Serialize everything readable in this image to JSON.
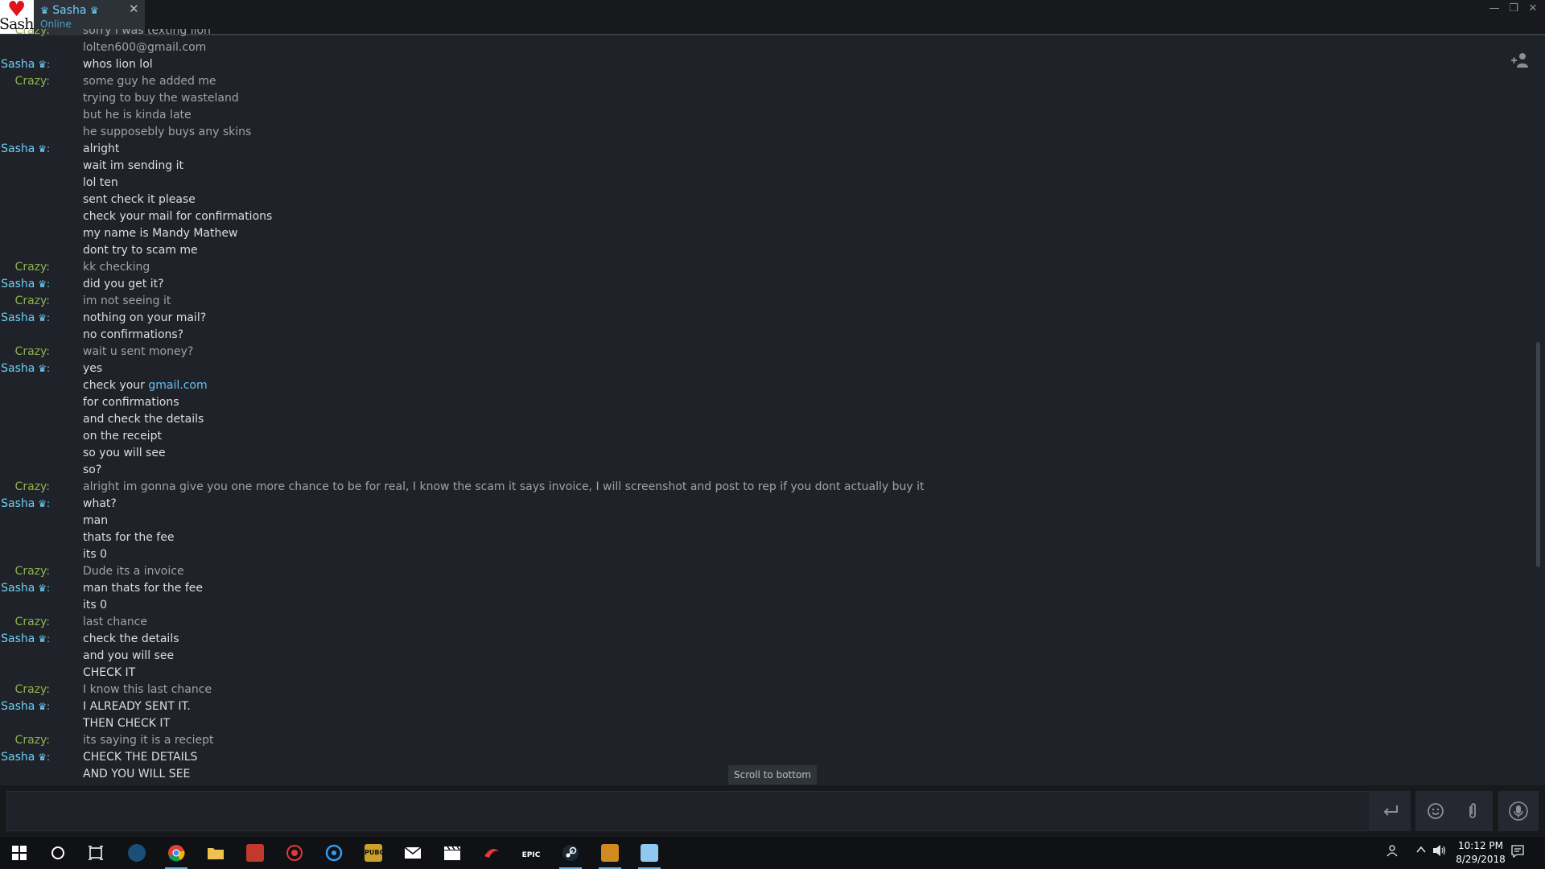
{
  "window": {
    "tab_name": "Sasha",
    "tab_status": "Online",
    "avatar_text": "Sasha",
    "close_glyph": "✕",
    "minimize_glyph": "—",
    "restore_glyph": "❐",
    "window_close_glyph": "✕"
  },
  "colors": {
    "sasha": "#6dcff6",
    "crazy": "#8fb34f",
    "link": "#67c1f5",
    "background": "#1f2228"
  },
  "senders": {
    "sasha": "Sasha",
    "crazy": "Crazy:"
  },
  "messages": [
    {
      "sender": "crazy",
      "text": "sorry i was texting lion"
    },
    {
      "sender": "",
      "text": "lolten600@gmail.com",
      "prev": "crazy"
    },
    {
      "sender": "sasha",
      "text": "whos lion lol"
    },
    {
      "sender": "crazy",
      "text": "some guy he added me"
    },
    {
      "sender": "",
      "text": "trying to buy the wasteland",
      "prev": "crazy"
    },
    {
      "sender": "",
      "text": "but he is kinda late",
      "prev": "crazy"
    },
    {
      "sender": "",
      "text": "he supposebly buys any skins",
      "prev": "crazy"
    },
    {
      "sender": "sasha",
      "text": "alright"
    },
    {
      "sender": "",
      "text": "wait im sending it",
      "prev": "sasha"
    },
    {
      "sender": "",
      "text": "lol ten",
      "prev": "sasha"
    },
    {
      "sender": "",
      "text": "sent check it please",
      "prev": "sasha"
    },
    {
      "sender": "",
      "text": "check your mail for confirmations",
      "prev": "sasha"
    },
    {
      "sender": "",
      "text": "my name is Mandy Mathew",
      "prev": "sasha"
    },
    {
      "sender": "",
      "text": "dont try to scam me",
      "prev": "sasha"
    },
    {
      "sender": "crazy",
      "text": "kk checking"
    },
    {
      "sender": "sasha",
      "text": "did you get it?"
    },
    {
      "sender": "crazy",
      "text": "im not seeing it"
    },
    {
      "sender": "sasha",
      "text": "nothing on your mail?"
    },
    {
      "sender": "",
      "text": "no confirmations?",
      "prev": "sasha"
    },
    {
      "sender": "crazy",
      "text": "wait u sent money?"
    },
    {
      "sender": "sasha",
      "text": "yes"
    },
    {
      "sender": "",
      "text": "check your ",
      "link": "gmail.com",
      "prev": "sasha"
    },
    {
      "sender": "",
      "text": "for confirmations",
      "prev": "sasha"
    },
    {
      "sender": "",
      "text": "and check the details",
      "prev": "sasha"
    },
    {
      "sender": "",
      "text": "on the receipt",
      "prev": "sasha"
    },
    {
      "sender": "",
      "text": "so you will see",
      "prev": "sasha"
    },
    {
      "sender": "",
      "text": "so?",
      "prev": "sasha"
    },
    {
      "sender": "crazy",
      "text": "alright im gonna give you one more chance to be for real, I know the scam it says invoice, I will screenshot and post to rep if you dont actually buy it"
    },
    {
      "sender": "sasha",
      "text": "what?"
    },
    {
      "sender": "",
      "text": "man",
      "prev": "sasha"
    },
    {
      "sender": "",
      "text": "thats for the fee",
      "prev": "sasha"
    },
    {
      "sender": "",
      "text": "its 0",
      "prev": "sasha"
    },
    {
      "sender": "crazy",
      "text": "Dude its a invoice"
    },
    {
      "sender": "sasha",
      "text": "man thats for the fee"
    },
    {
      "sender": "",
      "text": "its 0",
      "prev": "sasha"
    },
    {
      "sender": "crazy",
      "text": "last chance"
    },
    {
      "sender": "sasha",
      "text": "check the details"
    },
    {
      "sender": "",
      "text": "and you will see",
      "prev": "sasha"
    },
    {
      "sender": "",
      "text": "CHECK IT",
      "prev": "sasha"
    },
    {
      "sender": "crazy",
      "text": "I know this last chance"
    },
    {
      "sender": "sasha",
      "text": "I ALREADY SENT IT."
    },
    {
      "sender": "",
      "text": "THEN CHECK IT",
      "prev": "sasha"
    },
    {
      "sender": "crazy",
      "text": "its saying it is a reciept"
    },
    {
      "sender": "sasha",
      "text": "CHECK THE DETAILS"
    },
    {
      "sender": "",
      "text": "AND YOU WILL SEE",
      "prev": "sasha"
    }
  ],
  "scroll_to_bottom": "Scroll to bottom",
  "input": {
    "value": "",
    "send_icon": "enter-icon",
    "emoji_icon": "smiley-icon",
    "attach_icon": "paperclip-icon",
    "voice_icon": "microphone-icon"
  },
  "taskbar": {
    "time": "10:12 PM",
    "date": "8/29/2018",
    "apps": [
      {
        "name": "start",
        "icon": "windows-start-icon"
      },
      {
        "name": "search",
        "icon": "cortana-circle-icon"
      },
      {
        "name": "task-view",
        "icon": "task-view-icon"
      },
      {
        "name": "steam",
        "icon": "steam-icon"
      },
      {
        "name": "chrome",
        "icon": "chrome-icon"
      },
      {
        "name": "file-explorer",
        "icon": "folder-icon"
      },
      {
        "name": "app-red",
        "icon": "red-app-icon"
      },
      {
        "name": "app-target",
        "icon": "target-app-icon"
      },
      {
        "name": "app-refresh",
        "icon": "blue-app-icon"
      },
      {
        "name": "pubg",
        "icon": "pubg-icon"
      },
      {
        "name": "mail",
        "icon": "mail-icon"
      },
      {
        "name": "movies",
        "icon": "clapper-icon"
      },
      {
        "name": "app-wing",
        "icon": "red-wing-icon"
      },
      {
        "name": "epic",
        "icon": "epic-games-icon"
      },
      {
        "name": "steam-active",
        "icon": "steam-icon"
      },
      {
        "name": "csgo",
        "icon": "csgo-icon"
      },
      {
        "name": "notepad",
        "icon": "notepad-icon"
      }
    ],
    "pubg_label": "PUBG",
    "epic_label": "EPIC"
  }
}
